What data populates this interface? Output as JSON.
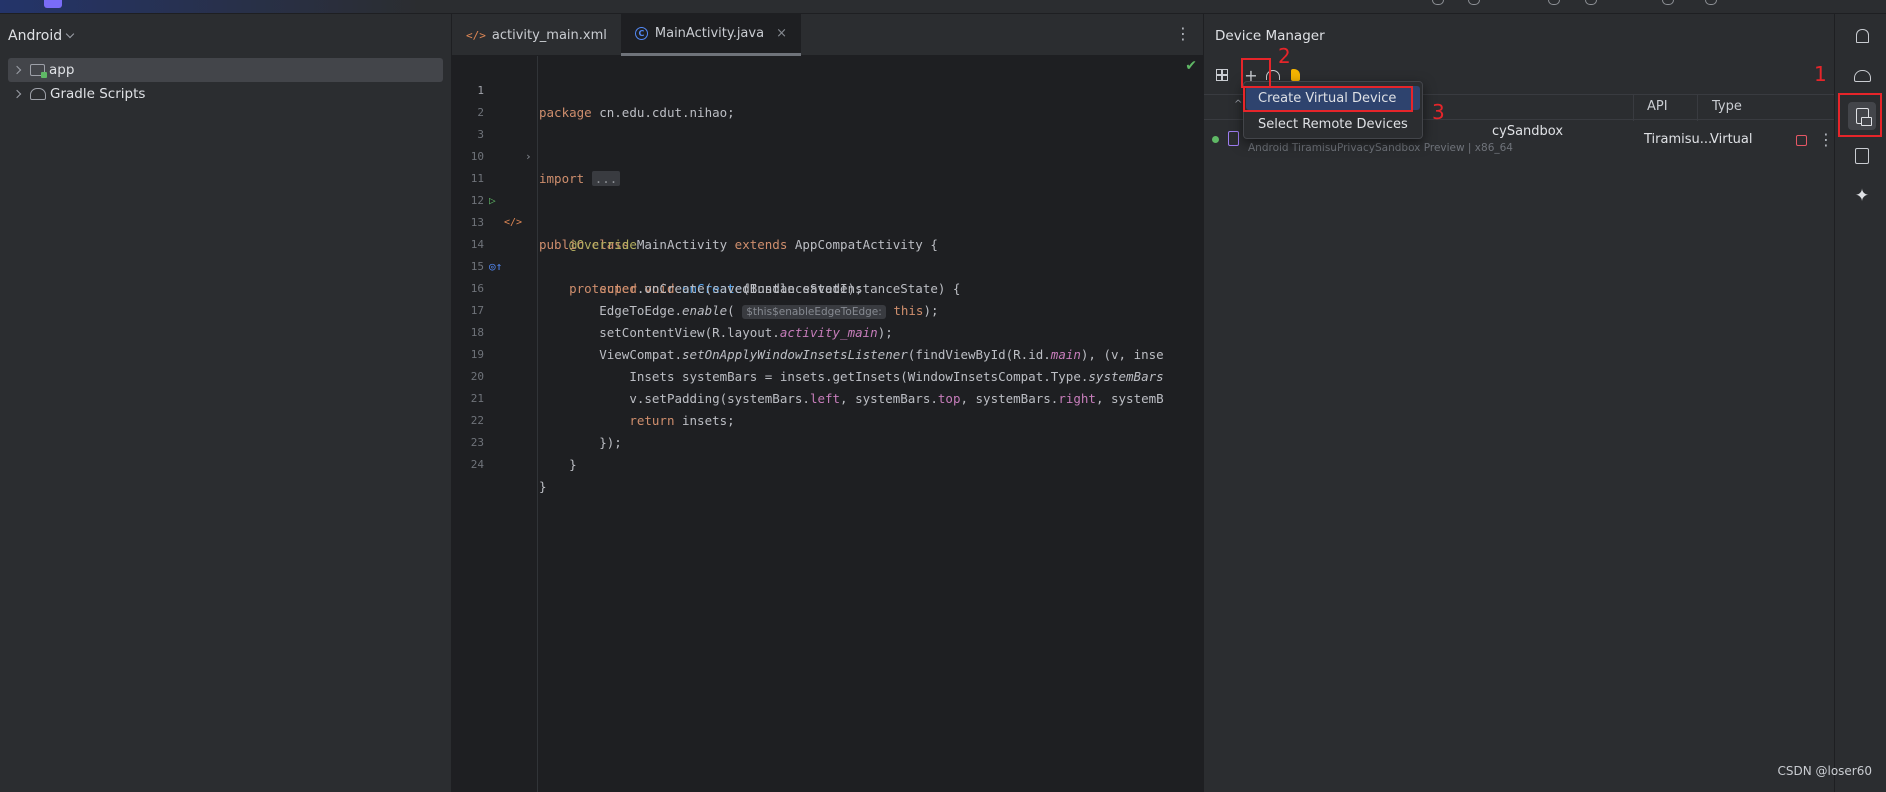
{
  "project": {
    "view_label": "Android",
    "tree": [
      {
        "label": "app",
        "selected": true
      },
      {
        "label": "Gradle Scripts",
        "selected": false
      }
    ]
  },
  "editor": {
    "tabs": [
      {
        "label": "activity_main.xml",
        "icon": "xml-file-icon",
        "active": false
      },
      {
        "label": "MainActivity.java",
        "icon": "java-class-icon",
        "active": true
      }
    ],
    "lines": [
      {
        "n": "1"
      },
      {
        "n": "2"
      },
      {
        "n": "3"
      },
      {
        "n": "10"
      },
      {
        "n": "11"
      },
      {
        "n": "12"
      },
      {
        "n": "13"
      },
      {
        "n": "14"
      },
      {
        "n": "15"
      },
      {
        "n": "16"
      },
      {
        "n": "17"
      },
      {
        "n": "18"
      },
      {
        "n": "19"
      },
      {
        "n": "20"
      },
      {
        "n": "21"
      },
      {
        "n": "22"
      },
      {
        "n": "23"
      },
      {
        "n": "24"
      }
    ],
    "code": {
      "package_kw": "package",
      "package_name": " cn.edu.cdut.nihao;",
      "import_kw": "import",
      "import_fold": "...",
      "class_line_a": "public class",
      "class_line_b": " MainActivity ",
      "class_line_c": "extends",
      "class_line_d": " AppCompatActivity {",
      "override": "@Override",
      "oncreate_a": "protected void",
      "oncreate_b": "onCreate",
      "oncreate_c": "(Bundle savedInstanceState) {",
      "super_a": "super",
      "super_b": ".onCreate(savedInstanceState);",
      "edge_a": "EdgeToEdge.",
      "edge_b": "enable",
      "edge_c": "(",
      "edge_hint": "$this$enableEdgeToEdge:",
      "edge_d": "this",
      "edge_e": ");",
      "setcv_a": "setContentView(R.layout.",
      "setcv_b": "activity_main",
      "setcv_c": ");",
      "vc_a": "ViewCompat.",
      "vc_b": "setOnApplyWindowInsetsListener",
      "vc_c": "(findViewById(R.id.",
      "vc_d": "main",
      "vc_e": "), (v, inse",
      "insets_a": "Insets systemBars = insets.getInsets(WindowInsetsCompat.Type.",
      "insets_b": "systemBars",
      "pad_a": "v.setPadding(systemBars.",
      "pad_b": "left",
      "pad_c": ", systemBars.",
      "pad_d": "top",
      "pad_e": ", systemBars.",
      "pad_f": "right",
      "pad_g": ", systemB",
      "return_kw": "return",
      "return_val": " insets;",
      "close_lambda": "});",
      "close_method": "}",
      "close_class": "}"
    }
  },
  "device_manager": {
    "title": "Device Manager",
    "columns": {
      "api": "API",
      "type": "Type"
    },
    "device": {
      "name": "cySandbox",
      "subtitle": "Android TiramisuPrivacySandbox Preview | x86_64",
      "api": "Tiramisu...",
      "type": "Virtual"
    },
    "menu": [
      {
        "label": "Create Virtual Device",
        "active": true
      },
      {
        "label": "Select Remote Devices",
        "active": false
      }
    ]
  },
  "annotations": {
    "n1": "1",
    "n2": "2",
    "n3": "3"
  },
  "watermark": "CSDN @loser60",
  "colors": {
    "accent_red": "#e6252a",
    "menu_highlight": "#2e436e",
    "keyword": "#cf8e6d",
    "function": "#56a8f5"
  }
}
